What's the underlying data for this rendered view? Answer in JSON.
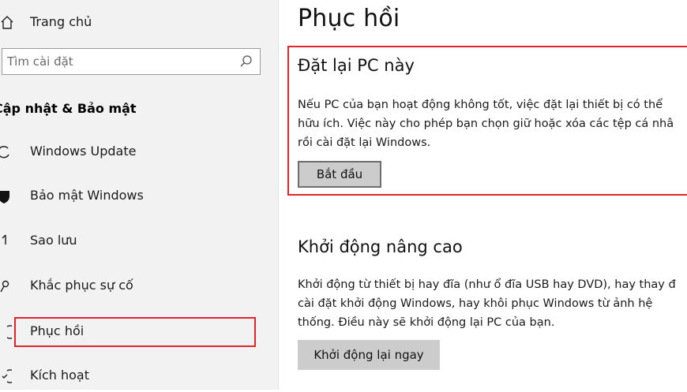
{
  "sidebar": {
    "home_label": "Trang chủ",
    "search_placeholder": "Tìm cài đặt",
    "section_title": "Cập nhật & Bảo mật",
    "items": [
      {
        "label": "Windows Update",
        "icon": "refresh-icon"
      },
      {
        "label": "Bảo mật Windows",
        "icon": "shield-icon"
      },
      {
        "label": "Sao lưu",
        "icon": "backup-arrow-icon"
      },
      {
        "label": "Khắc phục sự cố",
        "icon": "wrench-icon"
      },
      {
        "label": "Phục hồi",
        "icon": "recovery-icon",
        "selected": true
      },
      {
        "label": "Kích hoạt",
        "icon": "check-circle-icon"
      }
    ]
  },
  "main": {
    "title": "Phục hồi",
    "reset": {
      "heading": "Đặt lại PC này",
      "lines": [
        "Nếu PC của bạn hoạt động không tốt, việc đặt lại thiết bị có thể",
        "hữu ích. Việc này cho phép bạn chọn giữ hoặc xóa các tệp cá nhâ",
        "rồi cài đặt lại Windows."
      ],
      "button_label": "Bắt đầu"
    },
    "advanced": {
      "heading": "Khởi động nâng cao",
      "lines": [
        "Khởi động từ thiết bị hay đĩa (như ổ đĩa USB hay DVD), hay thay đ",
        "cài đặt khởi động Windows, hay khôi phục Windows từ ảnh hệ",
        "thống. Điều này sẽ khởi động lại PC của bạn."
      ],
      "button_label": "Khởi động lại ngay"
    }
  },
  "colors": {
    "highlight": "#e0252b",
    "sidebar_bg": "#f2f2f2",
    "button_bg": "#cccccc"
  }
}
